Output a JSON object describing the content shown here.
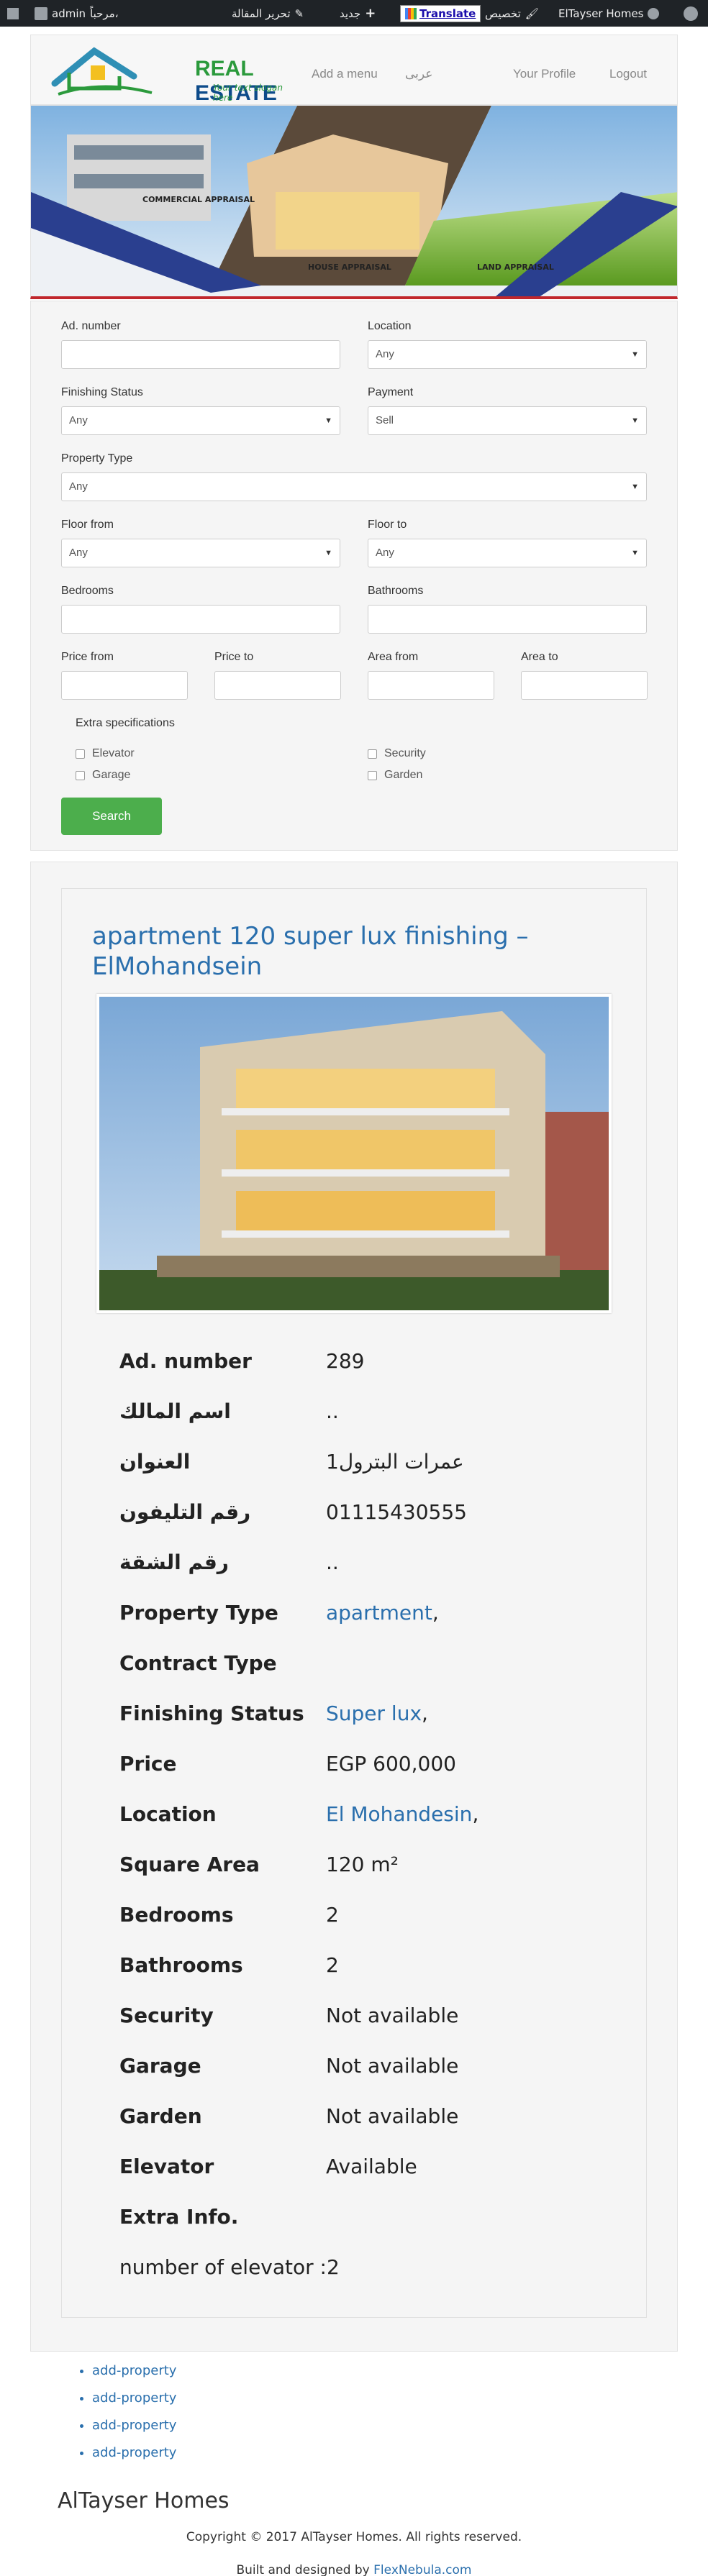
{
  "adminbar": {
    "wp_icon": "wordpress-logo-icon",
    "site_name": "ElTayser Homes",
    "customize": "تخصيص",
    "translate": "Translate",
    "new": "جديد",
    "edit_post": "تحرير المقالة",
    "greeting": "مرحباً،",
    "user": "admin"
  },
  "header": {
    "brand_real": "REAL",
    "brand_estate": "ESTATE",
    "slogan": "Your text slogan here",
    "nav": [
      "Add a menu",
      "عربى",
      "Your Profile",
      "Logout"
    ]
  },
  "banner": {
    "labels": [
      "COMMERCIAL APPRAISAL",
      "HOUSE APPRAISAL",
      "LAND APPRAISAL"
    ]
  },
  "search": {
    "ad_number_label": "Ad. number",
    "location_label": "Location",
    "location_value": "Any",
    "finishing_label": "Finishing Status",
    "finishing_value": "Any",
    "payment_label": "Payment",
    "payment_value": "Sell",
    "type_label": "Property Type",
    "type_value": "Any",
    "floor_from_label": "Floor from",
    "floor_from_value": "Any",
    "floor_to_label": "Floor to",
    "floor_to_value": "Any",
    "bedrooms_label": "Bedrooms",
    "bathrooms_label": "Bathrooms",
    "price_from_label": "Price from",
    "price_to_label": "Price to",
    "area_from_label": "Area from",
    "area_to_label": "Area to",
    "extra_label": "Extra specifications",
    "extras": [
      "Elevator",
      "Security",
      "Garage",
      "Garden"
    ],
    "search_button": "Search"
  },
  "listing": {
    "title": "apartment 120 super lux finishing – ElMohandsein",
    "details": [
      {
        "k": "Ad. number",
        "v": "289"
      },
      {
        "k": "اسم المالك",
        "v": ".."
      },
      {
        "k": "العنوان",
        "v": "عمرات البترول1"
      },
      {
        "k": "رقم التليفون",
        "v": "01115430555"
      },
      {
        "k": "رقم الشقة",
        "v": ".."
      },
      {
        "k": "Property Type",
        "v": "apartment",
        "suffix": ","
      },
      {
        "k": "Contract Type",
        "v": ""
      },
      {
        "k": "Finishing Status",
        "v": "Super lux",
        "suffix": ","
      },
      {
        "k": "Price",
        "v": "EGP 600,000"
      },
      {
        "k": "Location",
        "v": "El Mohandesin",
        "suffix": ","
      },
      {
        "k": "Square Area",
        "v": "120 m²"
      },
      {
        "k": "Bedrooms",
        "v": "2"
      },
      {
        "k": "Bathrooms",
        "v": "2"
      },
      {
        "k": "Security",
        "v": "Not available"
      },
      {
        "k": "Garage",
        "v": "Not available"
      },
      {
        "k": "Garden",
        "v": "Not available"
      },
      {
        "k": "Elevator",
        "v": "Available"
      },
      {
        "k": "Extra Info.",
        "v": ""
      }
    ],
    "extra_info_text": "number of elevator :2"
  },
  "footer": {
    "links": [
      "add-property",
      "add-property",
      "add-property",
      "add-property"
    ],
    "brand": "AlTayser Homes",
    "copyright": "Copyright © 2017 AlTayser Homes. All rights reserved.",
    "built_prefix": "Built and designed by",
    "built_link": "FlexNebula.com"
  }
}
